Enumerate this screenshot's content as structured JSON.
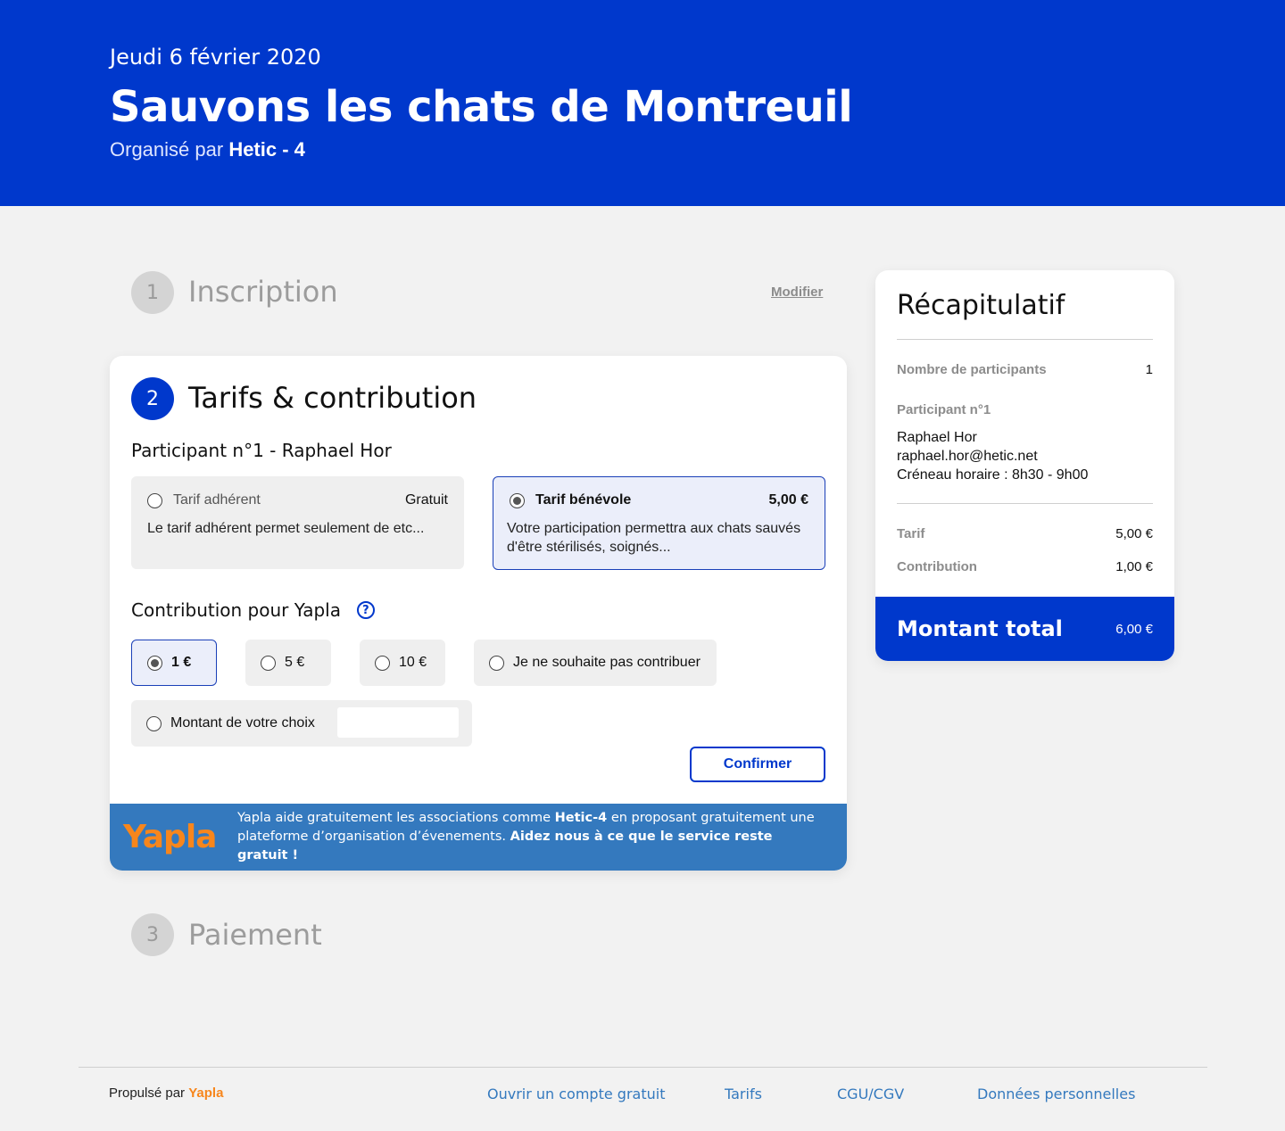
{
  "header": {
    "date": "Jeudi 6 février 2020",
    "title": "Sauvons les chats de Montreuil",
    "organized_prefix": "Organisé par",
    "organizer": "Hetic - 4"
  },
  "steps": {
    "step1": {
      "number": "1",
      "title": "Inscription",
      "edit_label": "Modifier"
    },
    "step2": {
      "number": "2",
      "title": "Tarifs & contribution"
    },
    "step3": {
      "number": "3",
      "title": "Paiement"
    }
  },
  "tarifs": {
    "participant_title": "Participant n°1 - Raphael Hor",
    "options": [
      {
        "label": "Tarif adhérent",
        "price": "Gratuit",
        "desc": "Le tarif adhérent permet seulement de etc...",
        "selected": false
      },
      {
        "label": "Tarif bénévole",
        "price": "5,00 €",
        "desc": "Votre participation permettra aux chats sauvés d'être stérilisés, soignés...",
        "selected": true
      }
    ]
  },
  "contribution": {
    "title": "Contribution pour Yapla",
    "help_icon": "question-circle-icon",
    "options": [
      {
        "label": "1 €",
        "selected": true
      },
      {
        "label": "5 €",
        "selected": false
      },
      {
        "label": "10 €",
        "selected": false
      },
      {
        "label": "Je ne souhaite pas contribuer",
        "selected": false
      }
    ],
    "custom_label": "Montant de votre choix",
    "custom_value": "",
    "confirm_label": "Confirmer"
  },
  "banner": {
    "logo": "Yapla",
    "text_1": "Yapla aide gratuitement les associations comme",
    "text_org": "Hetic-4",
    "text_2": "en proposant gratuitement une plateforme d’organisation d’évenements.",
    "text_cta": "Aidez nous à ce que le service reste gratuit !"
  },
  "summary": {
    "title": "Récapitulatif",
    "participants_label": "Nombre de participants",
    "participants_value": "1",
    "participant_label": "Participant n°1",
    "participant_name": "Raphael Hor",
    "participant_email": "raphael.hor@hetic.net",
    "participant_slot": "Créneau horaire : 8h30 - 9h00",
    "tarif_label": "Tarif",
    "tarif_value": "5,00 €",
    "contribution_label": "Contribution",
    "contribution_value": "1,00 €",
    "total_label": "Montant total",
    "total_value": "6,00 €"
  },
  "footer": {
    "powered_prefix": "Propulsé par",
    "powered_brand": "Yapla",
    "links": [
      "Ouvrir un compte gratuit",
      "Tarifs",
      "CGU/CGV",
      "Données personnelles"
    ]
  },
  "colors": {
    "primary": "#0038cc",
    "banner": "#3479be",
    "brand_orange": "#f7861c",
    "background": "#f2f2f2"
  }
}
